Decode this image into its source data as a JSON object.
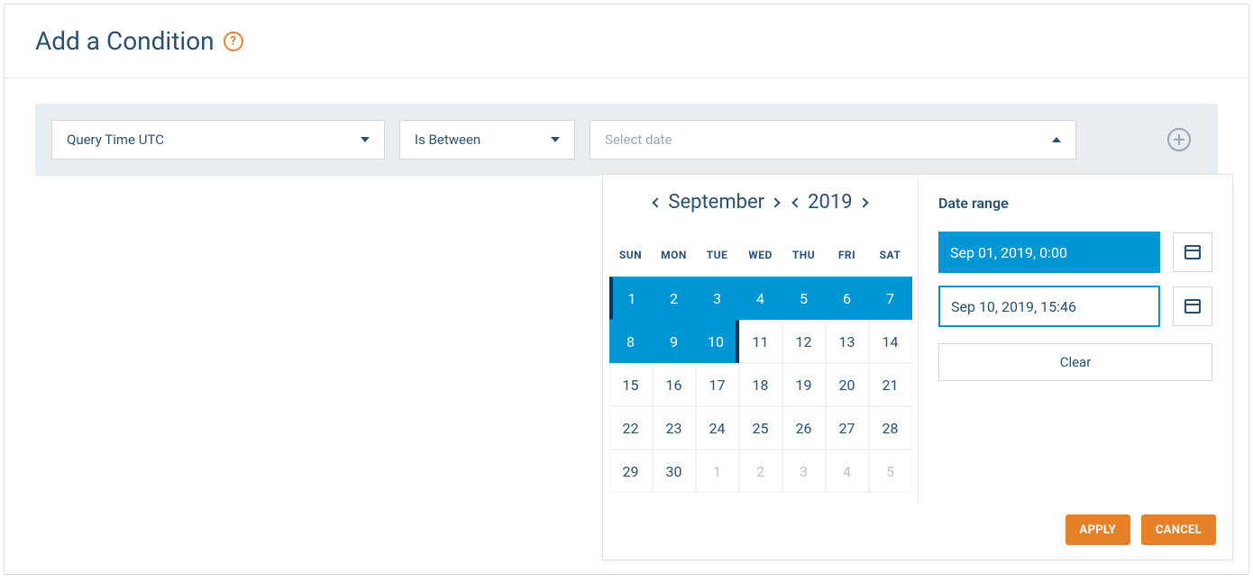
{
  "header": {
    "title": "Add a Condition"
  },
  "condition": {
    "field_label": "Query Time UTC",
    "operator_label": "Is Between",
    "date_placeholder": "Select date"
  },
  "calendar": {
    "month": "September",
    "year": "2019",
    "dow": [
      "SUN",
      "MON",
      "TUE",
      "WED",
      "THU",
      "FRI",
      "SAT"
    ],
    "days": [
      {
        "n": "1",
        "sel": true,
        "start": true
      },
      {
        "n": "2",
        "sel": true
      },
      {
        "n": "3",
        "sel": true
      },
      {
        "n": "4",
        "sel": true
      },
      {
        "n": "5",
        "sel": true
      },
      {
        "n": "6",
        "sel": true
      },
      {
        "n": "7",
        "sel": true
      },
      {
        "n": "8",
        "sel": true
      },
      {
        "n": "9",
        "sel": true
      },
      {
        "n": "10",
        "sel": true,
        "end": true
      },
      {
        "n": "11"
      },
      {
        "n": "12"
      },
      {
        "n": "13"
      },
      {
        "n": "14"
      },
      {
        "n": "15"
      },
      {
        "n": "16"
      },
      {
        "n": "17"
      },
      {
        "n": "18"
      },
      {
        "n": "19"
      },
      {
        "n": "20"
      },
      {
        "n": "21"
      },
      {
        "n": "22"
      },
      {
        "n": "23"
      },
      {
        "n": "24"
      },
      {
        "n": "25"
      },
      {
        "n": "26"
      },
      {
        "n": "27"
      },
      {
        "n": "28"
      },
      {
        "n": "29"
      },
      {
        "n": "30"
      },
      {
        "n": "1",
        "muted": true
      },
      {
        "n": "2",
        "muted": true
      },
      {
        "n": "3",
        "muted": true
      },
      {
        "n": "4",
        "muted": true
      },
      {
        "n": "5",
        "muted": true
      }
    ]
  },
  "range": {
    "title": "Date range",
    "from": "Sep 01, 2019, 0:00",
    "to": "Sep 10, 2019, 15:46",
    "clear_label": "Clear"
  },
  "footer": {
    "apply": "APPLY",
    "cancel": "CANCEL"
  }
}
